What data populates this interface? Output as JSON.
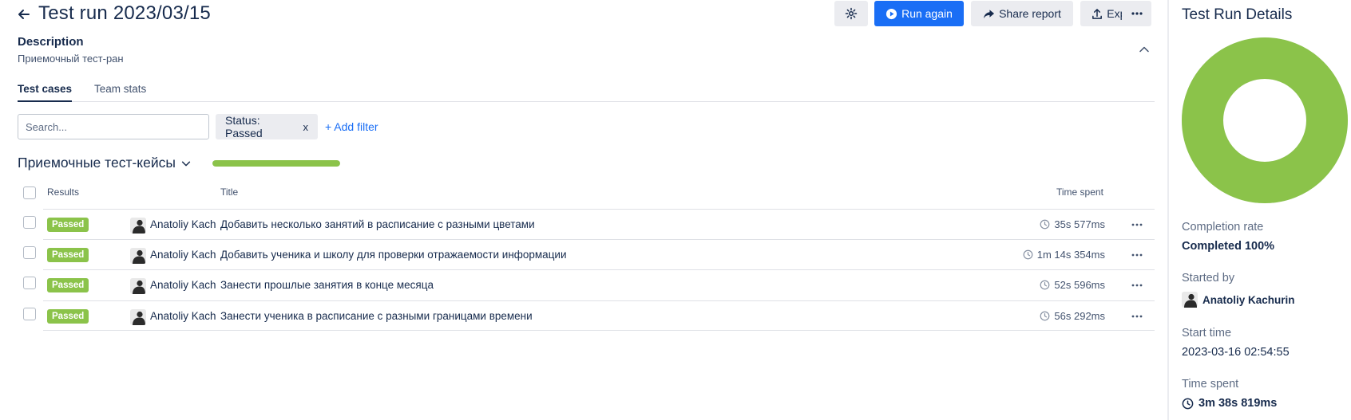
{
  "header": {
    "title": "Test run 2023/03/15",
    "run_again_label": "Run again",
    "share_label": "Share report",
    "export_label": "Export"
  },
  "description": {
    "heading": "Description",
    "text": "Приемочный тест-ран"
  },
  "tabs": [
    {
      "label": "Test cases",
      "active": true
    },
    {
      "label": "Team stats",
      "active": false
    }
  ],
  "search": {
    "placeholder": "Search...",
    "value": ""
  },
  "filter_chip": {
    "label": "Status: Passed",
    "remove": "x"
  },
  "add_filter_label": "+ Add filter",
  "group": {
    "title": "Приемочные тест-кейсы",
    "progress_fraction": 1.0
  },
  "table": {
    "headers": {
      "results": "Results",
      "title": "Title",
      "time": "Time spent"
    },
    "rows": [
      {
        "status": "Passed",
        "assignee": "Anatoliy Kachurin",
        "title": "Добавить несколько занятий в расписание с разными цветами",
        "time": "35s 577ms"
      },
      {
        "status": "Passed",
        "assignee": "Anatoliy Kachurin",
        "title": "Добавить ученика и школу для проверки отражаемости информации",
        "time": "1m 14s 354ms"
      },
      {
        "status": "Passed",
        "assignee": "Anatoliy Kachurin",
        "title": "Занести прошлые занятия в конце месяца",
        "time": "52s 596ms"
      },
      {
        "status": "Passed",
        "assignee": "Anatoliy Kachurin",
        "title": "Занести ученика в расписание с разными границами времени",
        "time": "56s 292ms"
      }
    ]
  },
  "details": {
    "title": "Test Run Details",
    "completion_label": "Completion rate",
    "completion_value": "Completed 100%",
    "completion_fraction": 1.0,
    "started_by_label": "Started by",
    "started_by_value": "Anatoliy Kachurin",
    "start_time_label": "Start time",
    "start_time_value": "2023-03-16 02:54:55",
    "time_spent_label": "Time spent",
    "time_spent_value": "3m 38s 819ms"
  },
  "colors": {
    "passed": "#8bc34a",
    "primary": "#1a6ef5",
    "text": "#172b4d",
    "button_bg": "#ebecf0"
  },
  "icons": {
    "back": "arrow-left-icon",
    "settings": "gear-icon",
    "run": "play-circle-icon",
    "share": "share-arrow-icon",
    "export": "upload-icon",
    "more": "more-horizontal-icon",
    "collapse": "chevron-up-icon",
    "group_toggle": "chevron-down-icon",
    "time": "clock-icon"
  }
}
